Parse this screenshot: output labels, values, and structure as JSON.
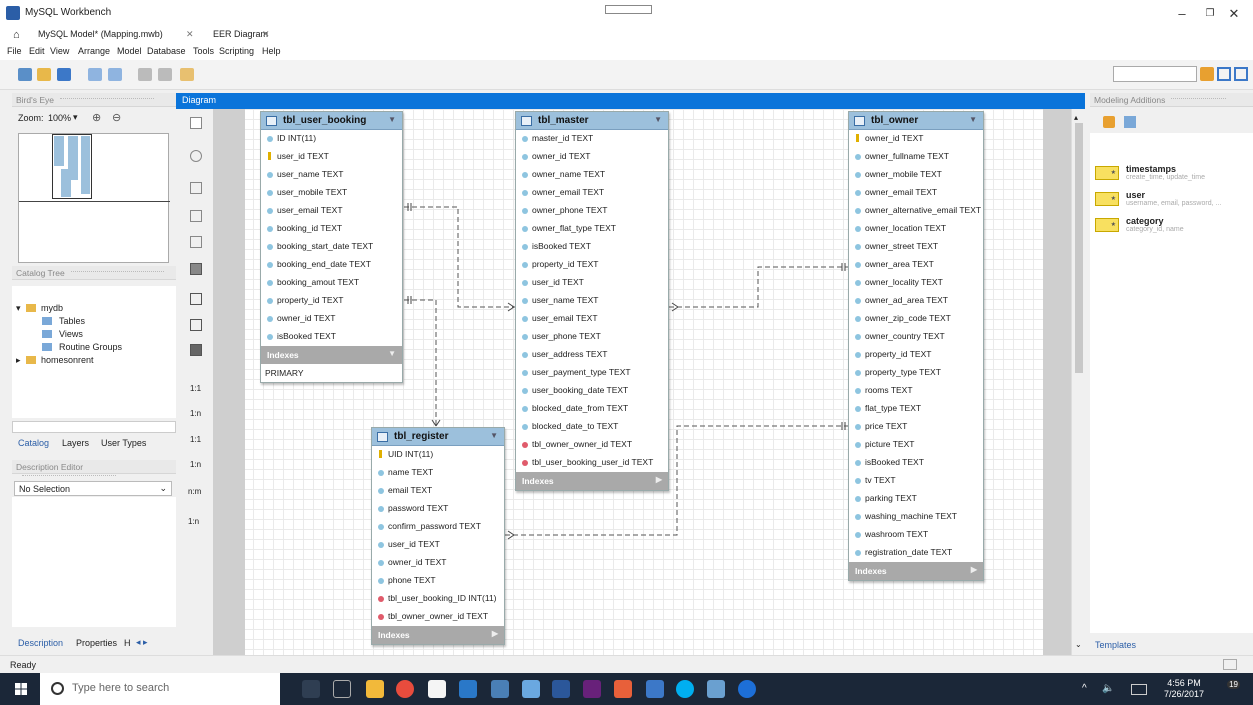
{
  "window": {
    "title": "MySQL Workbench"
  },
  "tabs": [
    {
      "label": "MySQL Model* (Mapping.mwb)"
    },
    {
      "label": "EER Diagram"
    }
  ],
  "menu": [
    "File",
    "Edit",
    "View",
    "Arrange",
    "Model",
    "Database",
    "Tools",
    "Scripting",
    "Help"
  ],
  "birds_eye": {
    "title": "Bird's Eye",
    "zoom_label": "Zoom:",
    "zoom_value": "100%"
  },
  "catalog": {
    "title": "Catalog Tree",
    "root": "mydb",
    "children": [
      "Tables",
      "Views",
      "Routine Groups"
    ],
    "other": "homesonrent"
  },
  "left_tabs": [
    "Catalog",
    "Layers",
    "User Types"
  ],
  "description": {
    "title": "Description Editor",
    "selection": "No Selection"
  },
  "bottom_tabs": [
    "Description",
    "Properties",
    "H"
  ],
  "diagram": {
    "title": "Diagram"
  },
  "tools": {
    "rel1": "1:1",
    "rel2": "1:n",
    "rel3": "1:1",
    "rel4": "1:n",
    "rel5": "n:m",
    "rel6": "1:n"
  },
  "tables": {
    "user_booking": {
      "name": "tbl_user_booking",
      "columns": [
        "ID INT(11)",
        "user_id TEXT",
        "user_name TEXT",
        "user_mobile TEXT",
        "user_email TEXT",
        "booking_id TEXT",
        "booking_start_date TEXT",
        "booking_end_date TEXT",
        "booking_amout TEXT",
        "property_id TEXT",
        "owner_id TEXT",
        "isBooked TEXT"
      ],
      "indexes": "Indexes",
      "index_rows": [
        "PRIMARY"
      ]
    },
    "master": {
      "name": "tbl_master",
      "columns": [
        "master_id TEXT",
        "owner_id TEXT",
        "owner_name TEXT",
        "owner_email TEXT",
        "owner_phone TEXT",
        "owner_flat_type TEXT",
        "isBooked TEXT",
        "property_id TEXT",
        "user_id TEXT",
        "user_name TEXT",
        "user_email TEXT",
        "user_phone TEXT",
        "user_address TEXT",
        "user_payment_type TEXT",
        "user_booking_date TEXT",
        "blocked_date_from TEXT",
        "blocked_date_to TEXT",
        "tbl_owner_owner_id TEXT",
        "tbl_user_booking_user_id TEXT"
      ],
      "indexes": "Indexes"
    },
    "register": {
      "name": "tbl_register",
      "columns": [
        "UID INT(11)",
        "name TEXT",
        "email TEXT",
        "password TEXT",
        "confirm_password TEXT",
        "user_id TEXT",
        "owner_id TEXT",
        "phone TEXT",
        "tbl_user_booking_ID INT(11)",
        "tbl_owner_owner_id TEXT"
      ],
      "indexes": "Indexes"
    },
    "owner": {
      "name": "tbl_owner",
      "columns": [
        "owner_id TEXT",
        "owner_fullname TEXT",
        "owner_mobile TEXT",
        "owner_email TEXT",
        "owner_alternative_email TEXT",
        "owner_location TEXT",
        "owner_street TEXT",
        "owner_area TEXT",
        "owner_locality TEXT",
        "owner_ad_area TEXT",
        "owner_zip_code TEXT",
        "owner_country TEXT",
        "property_id TEXT",
        "property_type TEXT",
        "rooms TEXT",
        "flat_type TEXT",
        "price TEXT",
        "picture TEXT",
        "isBooked TEXT",
        "tv TEXT",
        "parking TEXT",
        "washing_machine TEXT",
        "washroom TEXT",
        "registration_date TEXT"
      ],
      "indexes": "Indexes"
    }
  },
  "modeling": {
    "title": "Modeling Additions",
    "snippets": [
      {
        "name": "timestamps",
        "sub": "create_time, update_time"
      },
      {
        "name": "user",
        "sub": "username, email, password, ..."
      },
      {
        "name": "category",
        "sub": "category_id, name"
      }
    ],
    "templates": "Templates"
  },
  "status": "Ready",
  "taskbar": {
    "search": "Type here to search",
    "time": "4:56 PM",
    "date": "7/26/2017",
    "notif": "19"
  },
  "colors": {
    "accent": "#0a74da",
    "table_header": "#9cc0dc",
    "taskbar": "#1b2738"
  }
}
